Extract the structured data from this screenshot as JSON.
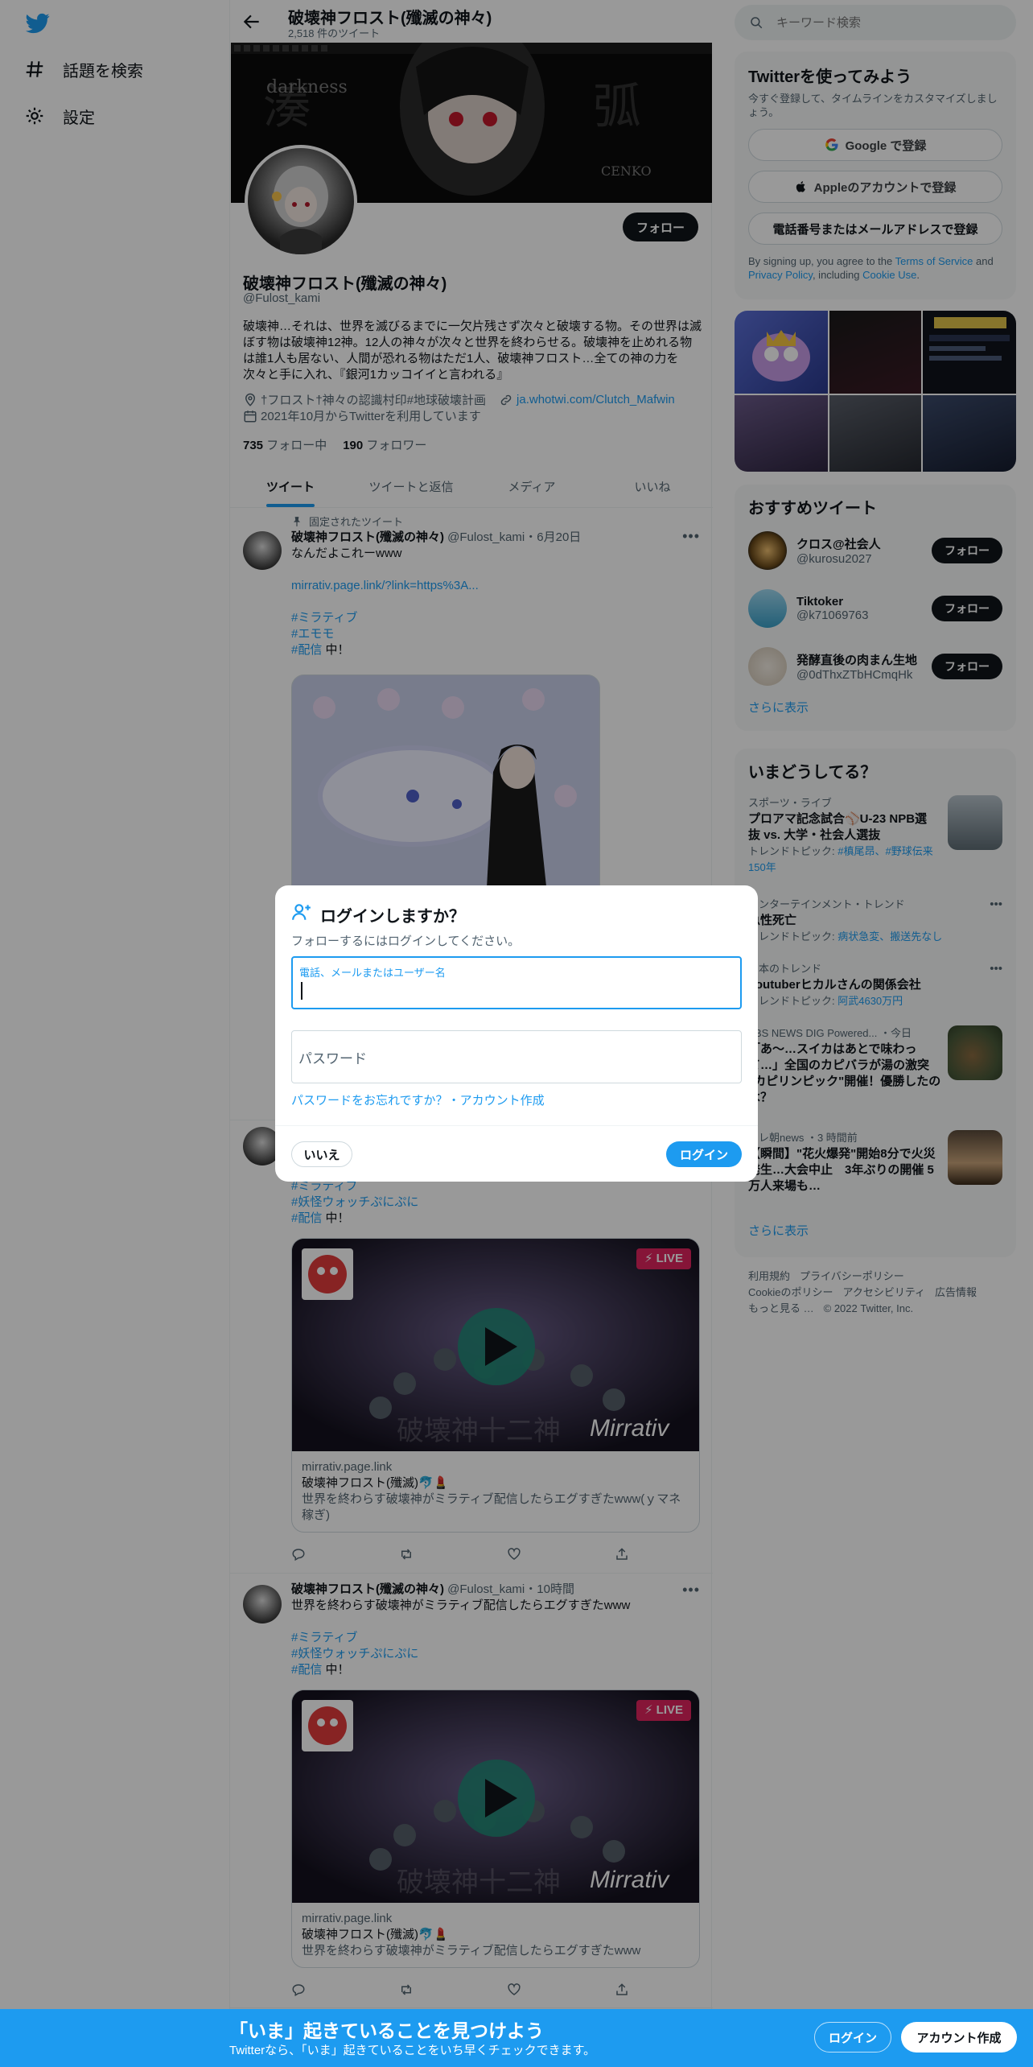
{
  "nav": {
    "explore_label": "話題を検索",
    "settings_label": "設定"
  },
  "header": {
    "title": "破壊神フロスト(殲滅の神々)",
    "tweet_count": "2,518 件のツイート"
  },
  "profile": {
    "name": "破壊神フロスト(殲滅の神々)",
    "handle": "@Fulost_kami",
    "follow_label": "フォロー",
    "bio": "破壊神…それは、世界を滅びるまでに一欠片残さず次々と破壊する物。その世界は滅ぼす物は破壊神12神。12人の神々が次々と世界を終わらせる。破壊神を止めれる物は誰1人も居ない、人間が恐れる物はただ1人、破壊神フロスト…全ての神の力を次々と手に入れ、『銀河1カッコイイと言われる』",
    "location": "†フロスト†神々の認識村印#地球破壊計画",
    "website": "ja.whotwi.com/Clutch_Mafwin",
    "joined": "2021年10月からTwitterを利用しています",
    "following_count": "735",
    "following_label": "フォロー中",
    "followers_count": "190",
    "followers_label": "フォロワー",
    "banner_text_left": "darkness",
    "banner_text_right": "CENKO"
  },
  "tabs": [
    "ツイート",
    "ツイートと返信",
    "メディア",
    "いいね"
  ],
  "tweets": [
    {
      "pinned_label": "固定されたツイート",
      "name": "破壊神フロスト(殲滅の神々)",
      "handle": "@Fulost_kami",
      "time": "・6月20日",
      "text": "なんだよこれーwww",
      "link": "mirrativ.page.link/?link=https%3A...",
      "tags": [
        "#ミラティブ",
        "#エモモ"
      ],
      "tag3": "#配信",
      "tag3_suffix": " 中！"
    },
    {
      "tags": [
        "#ミラティブ",
        "#妖怪ウォッチぷにぷに"
      ],
      "tag3": "#配信",
      "tag3_suffix": " 中！",
      "live_label": "LIVE",
      "watermark": "破壊神十二神",
      "brand": "Mirrativ",
      "card_domain": "mirrativ.page.link",
      "card_title": "破壊神フロスト(殲滅)🐬💄",
      "card_desc": "世界を終わらす破壊神がミラティブ配信したらエグすぎたwww(ｙマネ稼ぎ)"
    },
    {
      "name": "破壊神フロスト(殲滅の神々)",
      "handle": "@Fulost_kami",
      "time": "・10時間",
      "text": "世界を終わらす破壊神がミラティブ配信したらエグすぎたwww",
      "tags": [
        "#ミラティブ",
        "#妖怪ウォッチぷにぷに"
      ],
      "tag3": "#配信",
      "tag3_suffix": " 中！",
      "live_label": "LIVE",
      "watermark": "破壊神十二神",
      "brand": "Mirrativ",
      "card_domain": "mirrativ.page.link",
      "card_title": "破壊神フロスト(殲滅)🐬💄",
      "card_desc": "世界を終わらす破壊神がミラティブ配信したらエグすぎたwww"
    }
  ],
  "search": {
    "placeholder": "キーワード検索"
  },
  "signup": {
    "title": "Twitterを使ってみよう",
    "subtitle": "今すぐ登録して、タイムラインをカスタマイズしましょう。",
    "google": "Google で登録",
    "apple": "Appleのアカウントで登録",
    "phone": "電話番号またはメールアドレスで登録",
    "terms_prefix": "By signing up, you agree to the ",
    "terms_link": "Terms of Service",
    "terms_and": " and ",
    "privacy_link": "Privacy Policy",
    "terms_mid": ", including ",
    "cookie_link": "Cookie Use",
    "terms_end": "."
  },
  "who_to_follow": {
    "title": "おすすめツイート",
    "users": [
      {
        "name": "クロス@社会人",
        "handle": "@kurosu2027",
        "follow": "フォロー"
      },
      {
        "name": "Tiktoker",
        "handle": "@k71069763",
        "follow": "フォロー"
      },
      {
        "name": "発酵直後の肉まん生地",
        "handle": "@0dThxZTbHCmqHk",
        "follow": "フォロー"
      }
    ],
    "show_more": "さらに表示"
  },
  "trends": {
    "title": "いまどうしてる？",
    "items": [
      {
        "context": "スポーツ・ライブ",
        "title": "プロアマ記念試合⚾U-23 NPB選抜 vs. 大学・社会人選抜",
        "sub_prefix": "トレンドトピック: ",
        "sub_links": "#槙尾昂、#野球伝来150年"
      },
      {
        "context": "エンターテインメント・トレンド",
        "title": "急性死亡",
        "sub_prefix": "トレンドトピック: ",
        "sub_links": "病状急変、搬送先なし"
      },
      {
        "context": "日本のトレンド",
        "title": "Youtuberヒカルさんの関係会社",
        "sub_prefix": "トレンドトピック: ",
        "sub_links": "阿武4630万円"
      },
      {
        "context": "TBS NEWS DIG Powered... ・今日",
        "title": "「あ～…スイカはあとで味わって…」全国のカピバラが湯の激突 \"カピリンピック\"開催！優勝したのは？"
      },
      {
        "context": "テレ朝news ・3 時間前",
        "title": "【瞬間】\"花火爆発\"開始8分で火災発生…大会中止　3年ぶりの開催 5万人来場も…"
      }
    ],
    "show_more": "さらに表示"
  },
  "footer": {
    "links": [
      "利用規約",
      "プライバシーポリシー",
      "Cookieのポリシー",
      "アクセシビリティ",
      "広告情報",
      "もっと見る …"
    ],
    "copyright": "© 2022 Twitter, Inc."
  },
  "modal": {
    "title": "ログインしますか？",
    "subtitle": "フォローするにはログインしてください。",
    "id_label": "電話、メールまたはユーザー名",
    "password_placeholder": "パスワード",
    "forgot": "パスワードをお忘れですか？",
    "separator": "・",
    "create": "アカウント作成",
    "no_label": "いいえ",
    "login_label": "ログイン"
  },
  "bottom_bar": {
    "title": "「いま」起きていることを見つけよう",
    "subtitle": "Twitterなら、「いま」起きていることをいち早くチェックできます。",
    "login": "ログイン",
    "signup": "アカウント作成"
  },
  "colors": {
    "accent": "#1d9bf0",
    "dark": "#0f1419",
    "gray": "#536471"
  }
}
